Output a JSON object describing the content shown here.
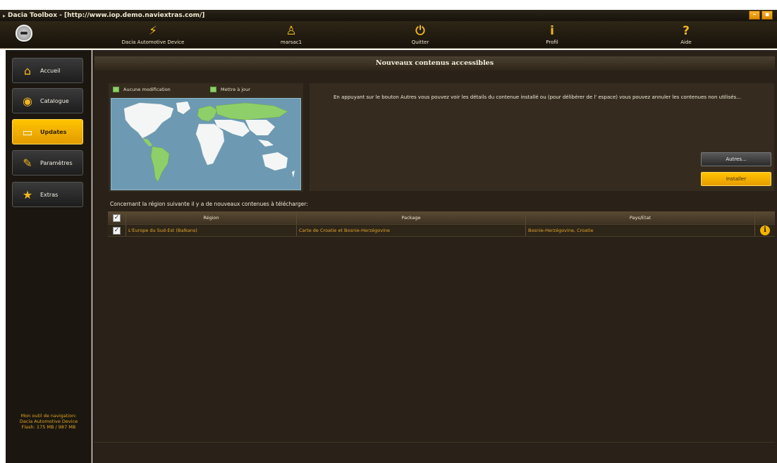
{
  "window": {
    "title": "Dacia Toolbox - [http://www.iop.demo.naviextras.com/]",
    "controls": [
      "–",
      "▪"
    ]
  },
  "toolbar": {
    "items": [
      {
        "label": "Dacia Automotive Device",
        "icon": "plug-icon",
        "glyph": "⚡"
      },
      {
        "label": "marsac1",
        "icon": "user-icon",
        "glyph": "♙"
      },
      {
        "label": "Quitter",
        "icon": "power-icon",
        "glyph": "⏻"
      },
      {
        "label": "Profil",
        "icon": "info-icon",
        "glyph": "i"
      },
      {
        "label": "Aide",
        "icon": "help-icon",
        "glyph": "?"
      }
    ]
  },
  "sidebar": {
    "items": [
      {
        "label": "Accueil",
        "icon": "home-icon",
        "glyph": "⌂",
        "active": false
      },
      {
        "label": "Catalogue",
        "icon": "globe-icon",
        "glyph": "◉",
        "active": false
      },
      {
        "label": "Updates",
        "icon": "monitor-update-icon",
        "glyph": "▭",
        "active": true
      },
      {
        "label": "Paramètres",
        "icon": "wrench-icon",
        "glyph": "✎",
        "active": false
      },
      {
        "label": "Extras",
        "icon": "star-icon",
        "glyph": "★",
        "active": false
      }
    ],
    "device_info": {
      "line1": "Mon outil de navigation:",
      "line2": "Dacia Automotive Device",
      "line3": "Flash: 175 MB / 987 MB"
    }
  },
  "main": {
    "header": "Nouveaux contenus accessibles",
    "legend": {
      "no_change": "Aucune modification",
      "update": "Mettre à jour"
    },
    "info_text": "En appuyant sur le bouton Autres vous pouvez voir les détails du contenue installé ou (pour délibérer de l' espace) vous pouvez annuler les contenues non utilisés...",
    "buttons": {
      "autres": "Autres...",
      "installer": "Installer"
    },
    "region_caption": "Concernant la région suivante il y a de nouveaux contenues à télécharger:",
    "table": {
      "headers": {
        "check": "✓",
        "region": "Région",
        "package": "Package",
        "pays": "Pays/Etat"
      },
      "rows": [
        {
          "checked": "✓",
          "region": "L'Europe du Sud-Est (Balkans)",
          "package": "Carte de Croatie et Bosnie-Herzégovine",
          "pays": "Bosnie-Herzégovine, Croatie",
          "info": "i"
        }
      ]
    }
  },
  "colors": {
    "accent": "#f2b622",
    "update_green": "#8fcf6a",
    "row_text": "#e2a628",
    "ocean": "#6d9ab2"
  }
}
